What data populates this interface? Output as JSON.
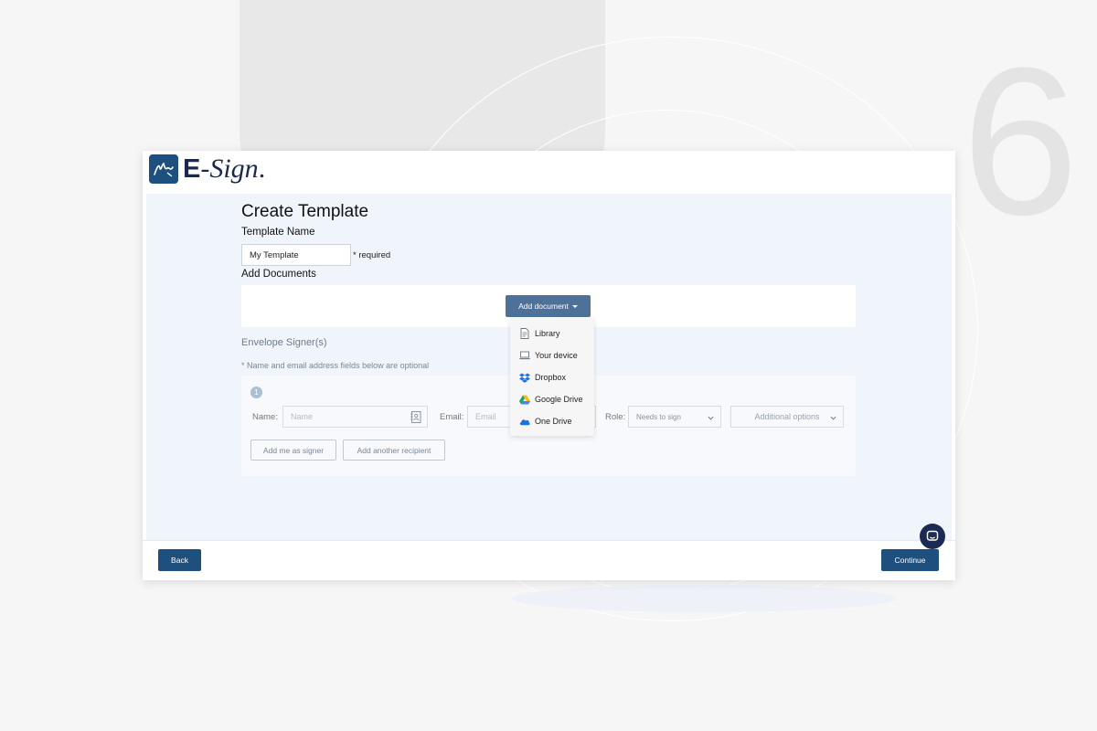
{
  "background": {
    "big_number": "6"
  },
  "app": {
    "logo_letter_e": "E",
    "logo_dash": "-",
    "logo_sign": "Sign",
    "logo_dot": "."
  },
  "page": {
    "title": "Create Template",
    "template_name_label": "Template Name",
    "template_name_value": "My Template",
    "required_text": "* required",
    "add_documents_label": "Add Documents",
    "add_document_button": "Add document",
    "envelope_signers_label": "Envelope Signer(s)",
    "optional_note": "* Name and email address fields below are optional"
  },
  "dropdown": {
    "items": [
      {
        "label": "Library",
        "icon": "document-icon"
      },
      {
        "label": "Your device",
        "icon": "laptop-icon"
      },
      {
        "label": "Dropbox",
        "icon": "dropbox-icon"
      },
      {
        "label": "Google Drive",
        "icon": "google-drive-icon"
      },
      {
        "label": "One Drive",
        "icon": "onedrive-icon"
      }
    ]
  },
  "signer": {
    "step_number": "1",
    "name_label": "Name:",
    "name_placeholder": "Name",
    "email_label": "Email:",
    "email_placeholder": "Email",
    "role_label": "Role:",
    "role_value": "Needs to sign",
    "additional_options": "Additional options",
    "add_me_button": "Add me as signer",
    "add_recipient_button": "Add another recipient"
  },
  "footer": {
    "back_button": "Back",
    "continue_button": "Continue"
  },
  "colors": {
    "primary": "#1f4f7c",
    "dropdown_button": "#4d7199",
    "content_background": "#f0f5fc",
    "chat_bubble": "#1c2b52"
  }
}
